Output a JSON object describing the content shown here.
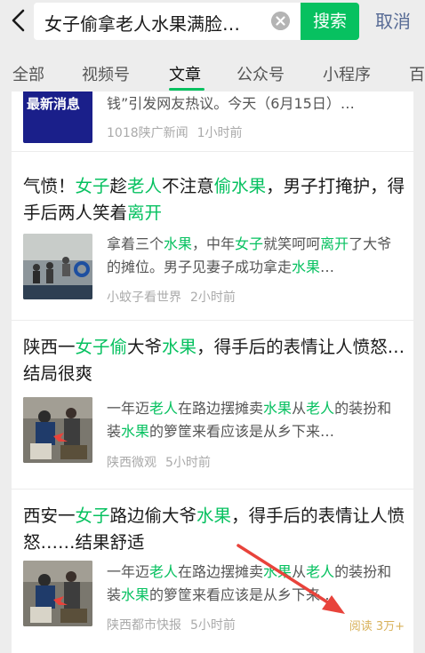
{
  "search": {
    "query": "女子偷拿老人水果满脸…",
    "search_label": "搜索",
    "cancel_label": "取消"
  },
  "tabs": [
    "全部",
    "视频号",
    "文章",
    "公众号",
    "小程序",
    "百"
  ],
  "active_tab": "文章",
  "results": [
    {
      "badge_text": "最新消息",
      "snippet": "钱”引发网友热议。今天（6月15日）…",
      "source": "1018陕广新闻",
      "time": "1小时前"
    },
    {
      "title_parts": [
        {
          "t": "气愤！",
          "h": false
        },
        {
          "t": "女子",
          "h": true
        },
        {
          "t": "趁",
          "h": false
        },
        {
          "t": "老人",
          "h": true
        },
        {
          "t": "不注意",
          "h": false
        },
        {
          "t": "偷水果",
          "h": true
        },
        {
          "t": "，男子打掩护，得手后两人笑着",
          "h": false
        },
        {
          "t": "离开",
          "h": true
        }
      ],
      "snippet_parts": [
        {
          "t": "拿着三个",
          "h": false
        },
        {
          "t": "水果",
          "h": true
        },
        {
          "t": "，中年",
          "h": false
        },
        {
          "t": "女子",
          "h": true
        },
        {
          "t": "就笑呵呵",
          "h": false
        },
        {
          "t": "离开",
          "h": true
        },
        {
          "t": "了大爷的摊位。男子见妻子成功拿走",
          "h": false
        },
        {
          "t": "水果",
          "h": true
        },
        {
          "t": "…",
          "h": false
        }
      ],
      "source": "小蚊子看世界",
      "time": "2小时前"
    },
    {
      "title_parts": [
        {
          "t": "陕西一",
          "h": false
        },
        {
          "t": "女子偷",
          "h": true
        },
        {
          "t": "大爷",
          "h": false
        },
        {
          "t": "水果",
          "h": true
        },
        {
          "t": "，得手后的表情让人愤怒…结局很爽",
          "h": false
        }
      ],
      "snippet_parts": [
        {
          "t": "一年迈",
          "h": false
        },
        {
          "t": "老人",
          "h": true
        },
        {
          "t": "在路边摆摊卖",
          "h": false
        },
        {
          "t": "水果",
          "h": true
        },
        {
          "t": "从",
          "h": false
        },
        {
          "t": "老人",
          "h": true
        },
        {
          "t": "的装扮和装",
          "h": false
        },
        {
          "t": "水果",
          "h": true
        },
        {
          "t": "的箩筐来看应该是从乡下来…",
          "h": false
        }
      ],
      "source": "陕西微观",
      "time": "5小时前"
    },
    {
      "title_parts": [
        {
          "t": "西安一",
          "h": false
        },
        {
          "t": "女子",
          "h": true
        },
        {
          "t": "路边偷大爷",
          "h": false
        },
        {
          "t": "水果",
          "h": true
        },
        {
          "t": "，得手后的表情让人愤怒……结果舒适",
          "h": false
        }
      ],
      "snippet_parts": [
        {
          "t": "一年迈",
          "h": false
        },
        {
          "t": "老人",
          "h": true
        },
        {
          "t": "在路边摆摊卖",
          "h": false
        },
        {
          "t": "水果",
          "h": true
        },
        {
          "t": "从",
          "h": false
        },
        {
          "t": "老人",
          "h": true
        },
        {
          "t": "的装扮和装",
          "h": false
        },
        {
          "t": "水果",
          "h": true
        },
        {
          "t": "的箩筐来看应该是从乡下来…",
          "h": false
        }
      ],
      "source": "陕西都市快报",
      "time": "5小时前",
      "reads": "阅读 3万+"
    }
  ],
  "colors": {
    "accent": "#07c160",
    "link": "#576b95",
    "arrow": "#e8433b",
    "reads": "#d8b15a"
  }
}
